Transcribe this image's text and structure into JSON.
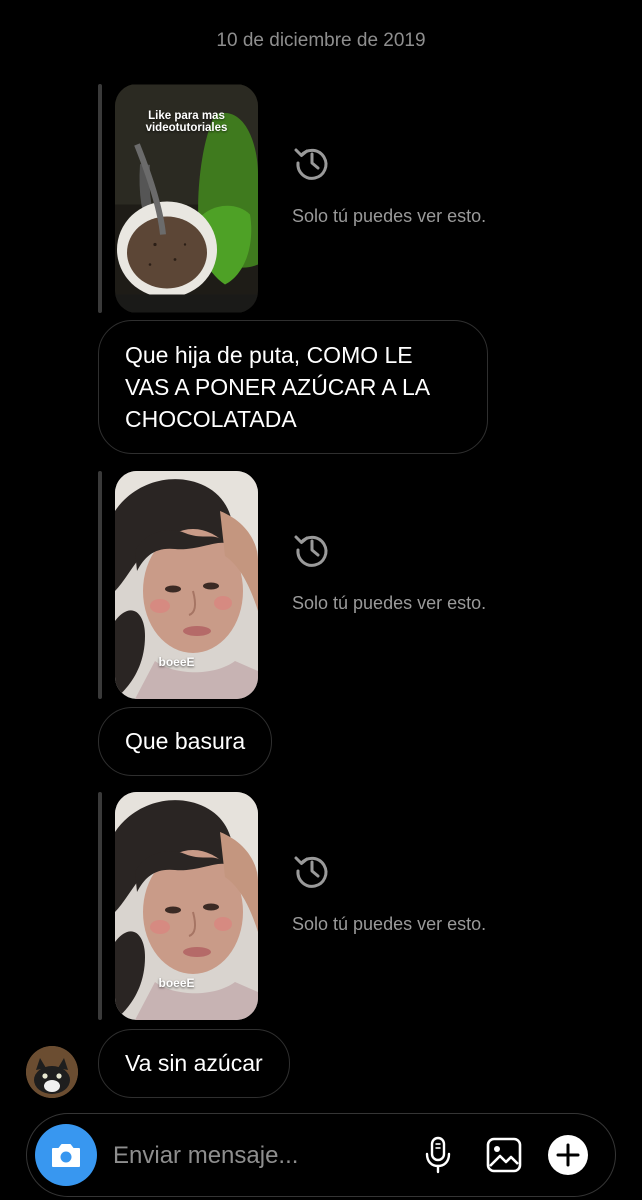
{
  "header": {
    "date": "10 de diciembre de 2019"
  },
  "messages": [
    {
      "type": "story_reply",
      "story_caption": "Like para mas videotutoriales",
      "expired_note": "Solo tú puedes ver esto."
    },
    {
      "type": "text",
      "text": "Que hija de puta, COMO LE VAS A PONER AZÚCAR A LA CHOCOLATADA"
    },
    {
      "type": "story_reply",
      "story_caption": "boeeE",
      "expired_note": "Solo tú puedes ver esto."
    },
    {
      "type": "text",
      "text": "Que basura"
    },
    {
      "type": "story_reply",
      "story_caption": "boeeE",
      "expired_note": "Solo tú puedes ver esto."
    },
    {
      "type": "text",
      "text": "Va sin azúcar"
    }
  ],
  "composer": {
    "placeholder": "Enviar mensaje...",
    "icons": [
      "camera-icon",
      "microphone-icon",
      "gallery-icon",
      "plus-icon"
    ],
    "accent_color": "#3897f0"
  },
  "icons": {
    "expired": "history-icon"
  }
}
